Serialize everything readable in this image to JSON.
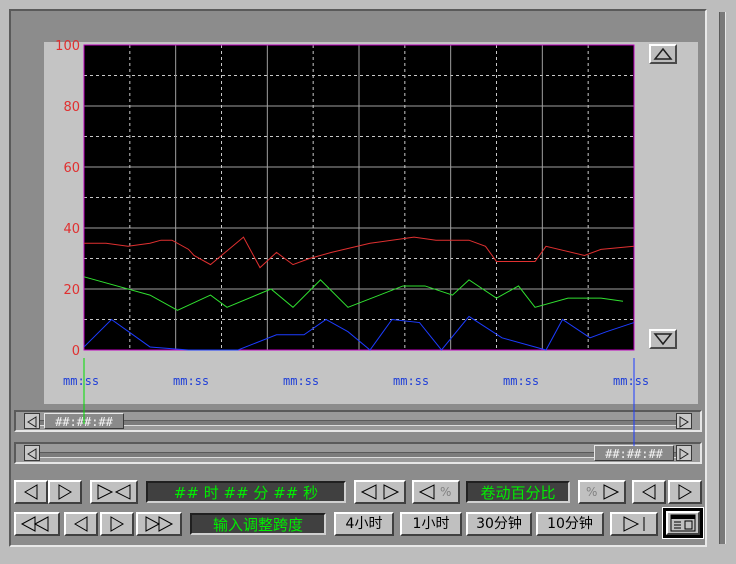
{
  "chart_data": {
    "type": "line",
    "ylim": [
      0,
      100
    ],
    "y_ticks": [
      "0",
      "20",
      "40",
      "60",
      "80",
      "100"
    ],
    "x_ticks": [
      "mm:ss",
      "mm:ss",
      "mm:ss",
      "mm:ss",
      "mm:ss",
      "mm:ss"
    ],
    "grid": true,
    "background": "#000000",
    "series": [
      {
        "color": "#e03030",
        "x": [
          0,
          4,
          8,
          12,
          14,
          16,
          19,
          20,
          23,
          29,
          32,
          35,
          38,
          41,
          45,
          52,
          60,
          64,
          70,
          73,
          75,
          82,
          84,
          91,
          94,
          100
        ],
        "y": [
          35,
          35,
          34,
          35,
          36,
          36,
          33,
          31,
          28,
          37,
          27,
          32,
          28,
          30,
          32,
          35,
          37,
          36,
          36,
          34,
          29,
          29,
          34,
          31,
          33,
          34
        ]
      },
      {
        "color": "#30e030",
        "x": [
          0,
          12,
          17,
          23,
          26,
          34,
          38,
          43,
          48,
          58,
          62,
          67,
          70,
          75,
          79,
          82,
          88,
          94,
          98
        ],
        "y": [
          24,
          18,
          13,
          18,
          14,
          20,
          14,
          23,
          14,
          21,
          21,
          18,
          23,
          17,
          21,
          14,
          17,
          17,
          16
        ]
      },
      {
        "color": "#1c3cff",
        "x": [
          0,
          5,
          12,
          19,
          28,
          35,
          40,
          44,
          48,
          52,
          56,
          61,
          65,
          70,
          76,
          84,
          87,
          92,
          95,
          100
        ],
        "y": [
          1,
          10,
          1,
          0,
          0,
          5,
          5,
          10,
          6,
          0,
          10,
          9,
          0,
          11,
          4,
          0,
          10,
          4,
          6,
          9
        ]
      }
    ]
  },
  "slider_top": {
    "time": "##:##:##"
  },
  "slider_bottom": {
    "time": "##:##:##"
  },
  "toolbar": {
    "time_display": "## 时 ## 分 ## 秒",
    "scroll_percent_label": "卷动百分比",
    "percent_symbol": "%",
    "span_input_label": "输入调整跨度",
    "btn_4h": "4小时",
    "btn_1h": "1小时",
    "btn_30m": "30分钟",
    "btn_10m": "10分钟"
  },
  "colors": {
    "axis_label": "#e03030",
    "time_label": "#1f3fd8",
    "cursor": "#00ff00"
  },
  "icons": [
    "arrow-up-icon",
    "arrow-down-icon",
    "arrow-left-icon",
    "arrow-right-icon",
    "collapse-icon",
    "fast-rewind-icon",
    "fast-forward-icon",
    "window-icon"
  ]
}
